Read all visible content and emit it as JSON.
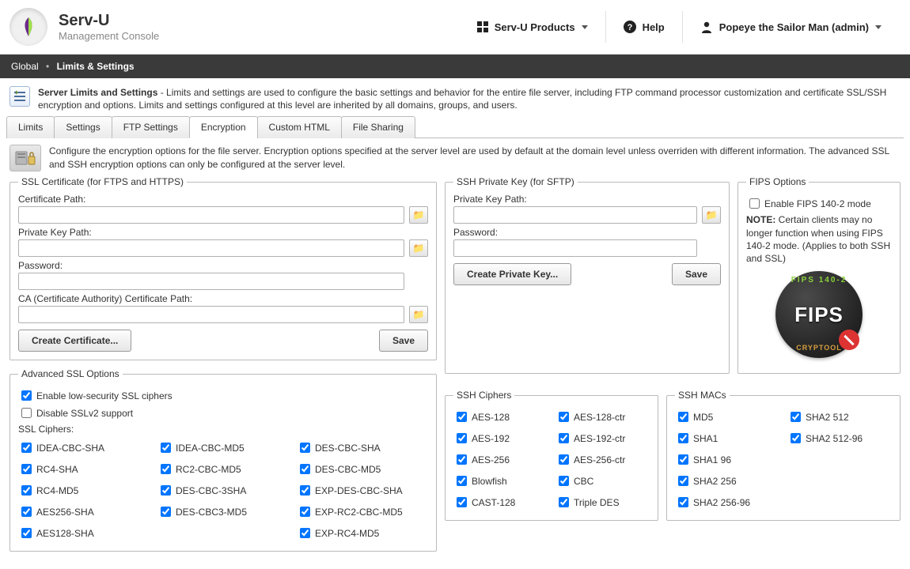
{
  "header": {
    "brand_title": "Serv-U",
    "brand_sub": "Management Console",
    "products_label": "Serv-U Products",
    "help_label": "Help",
    "user_label": "Popeye the Sailor Man (admin)"
  },
  "breadcrumb": {
    "root": "Global",
    "page": "Limits & Settings"
  },
  "section": {
    "title": "Server Limits and Settings",
    "desc": " - Limits and settings are used to configure the basic settings and behavior for the entire file server, including FTP command processor customization and certificate  SSL/SSH encryption and  options. Limits and settings configured at this level are inherited by all domains, groups, and users."
  },
  "tabs": [
    "Limits",
    "Settings",
    "FTP Settings",
    "Encryption",
    "Custom HTML",
    "File Sharing"
  ],
  "active_tab": "Encryption",
  "panel_desc": "Configure the encryption options for the file server. Encryption options specified at the server level are used by default at the domain level unless overriden with different information. The advanced SSL and SSH   encryption options can only be configured at the server level.",
  "ssl_cert": {
    "legend": "SSL Certificate (for FTPS and HTTPS)",
    "cert_path_label": "Certificate Path:",
    "cert_path_value": "",
    "priv_key_label": "Private Key Path:",
    "priv_key_value": "",
    "password_label": "Password:",
    "password_value": "",
    "ca_path_label": "CA (Certificate Authority) Certificate Path:",
    "ca_path_value": "",
    "create_btn": "Create Certificate...",
    "save_btn": "Save"
  },
  "ssh_key": {
    "legend": "SSH Private Key (for SFTP)",
    "priv_key_label": "Private Key Path:",
    "priv_key_value": "",
    "password_label": "Password:",
    "password_value": "",
    "create_btn": "Create Private Key...",
    "save_btn": "Save"
  },
  "fips": {
    "legend": "FIPS Options",
    "enable_label": "Enable FIPS 140-2 mode",
    "enable_checked": false,
    "note_prefix": "NOTE:",
    "note_text": " Certain clients may no longer function when using FIPS 140-2 mode. (Applies to both SSH and SSL)",
    "badge_text": "FIPS",
    "badge_top": "FIPS 140-2",
    "badge_bottom": "CRYPTOOL"
  },
  "adv_ssl": {
    "legend": "Advanced SSL Options",
    "enable_low_label": "Enable low-security SSL ciphers",
    "enable_low_checked": true,
    "disable_sslv2_label": "Disable SSLv2 support",
    "disable_sslv2_checked": false,
    "ciphers_label": "SSL Ciphers:",
    "ciphers": [
      {
        "label": "IDEA-CBC-SHA",
        "checked": true
      },
      {
        "label": "IDEA-CBC-MD5",
        "checked": true
      },
      {
        "label": "DES-CBC-SHA",
        "checked": true
      },
      {
        "label": "RC4-SHA",
        "checked": true
      },
      {
        "label": "RC2-CBC-MD5",
        "checked": true
      },
      {
        "label": "DES-CBC-MD5",
        "checked": true
      },
      {
        "label": "RC4-MD5",
        "checked": true
      },
      {
        "label": "DES-CBC-3SHA",
        "checked": true
      },
      {
        "label": "EXP-DES-CBC-SHA",
        "checked": true
      },
      {
        "label": "AES256-SHA",
        "checked": true
      },
      {
        "label": "DES-CBC3-MD5",
        "checked": true
      },
      {
        "label": "EXP-RC2-CBC-MD5",
        "checked": true
      },
      {
        "label": "AES128-SHA",
        "checked": true
      },
      {
        "label": "",
        "checked": false
      },
      {
        "label": "EXP-RC4-MD5",
        "checked": true
      }
    ]
  },
  "ssh_ciphers": {
    "legend": "SSH Ciphers",
    "items": [
      {
        "label": "AES-128",
        "checked": true
      },
      {
        "label": "AES-128-ctr",
        "checked": true
      },
      {
        "label": "AES-192",
        "checked": true
      },
      {
        "label": "AES-192-ctr",
        "checked": true
      },
      {
        "label": "AES-256",
        "checked": true
      },
      {
        "label": "AES-256-ctr",
        "checked": true
      },
      {
        "label": "Blowfish",
        "checked": true
      },
      {
        "label": "CBC",
        "checked": true
      },
      {
        "label": "CAST-128",
        "checked": true
      },
      {
        "label": "Triple DES",
        "checked": true
      }
    ]
  },
  "ssh_macs": {
    "legend": "SSH MACs",
    "items": [
      {
        "label": "MD5",
        "checked": true
      },
      {
        "label": "SHA2 512",
        "checked": true
      },
      {
        "label": "SHA1",
        "checked": true
      },
      {
        "label": "SHA2 512-96",
        "checked": true
      },
      {
        "label": "SHA1 96",
        "checked": true
      },
      {
        "label": "",
        "checked": false
      },
      {
        "label": "SHA2 256",
        "checked": true
      },
      {
        "label": "",
        "checked": false
      },
      {
        "label": "SHA2 256-96",
        "checked": true
      },
      {
        "label": "",
        "checked": false
      }
    ]
  }
}
